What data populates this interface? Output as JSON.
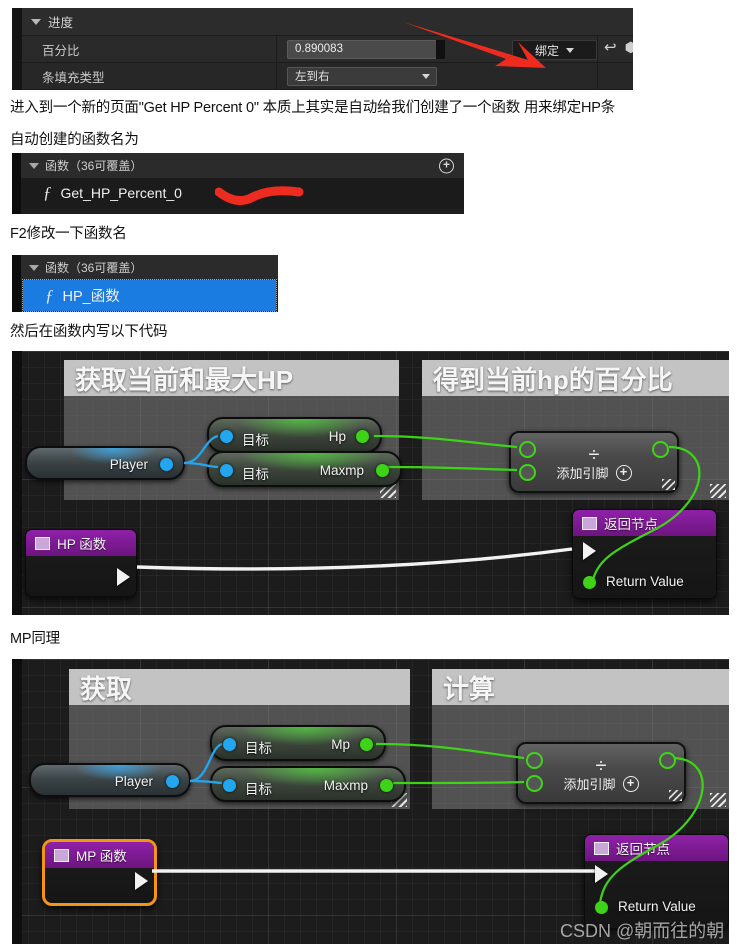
{
  "details_panel": {
    "category_label": "进度",
    "rows": [
      {
        "label": "百分比",
        "value": "0.890083"
      },
      {
        "label": "条填充类型",
        "value": "左到右"
      }
    ],
    "bind_button": "绑定",
    "reset_icon": "undo-arrow-icon",
    "bind_icon": "bind-diamond-icon"
  },
  "notes": {
    "line1": "进入到一个新的页面\"Get HP Percent 0\"  本质上其实是自动给我们创建了一个函数 用来绑定HP条",
    "line2": "自动创建的函数名为",
    "line3": "F2修改一下函数名",
    "line4": "然后在函数内写以下代码",
    "line5": "MP同理"
  },
  "function_panel_1": {
    "header": "函数（36可覆盖）",
    "add_icon": "plus-circle-icon",
    "item": "Get_HP_Percent_0",
    "item_icon": "function-f-icon"
  },
  "function_panel_2": {
    "header": "函数（36可覆盖）",
    "item": "HP_函数",
    "item_icon": "function-f-icon"
  },
  "graph_hp": {
    "comment_left_title": "获取当前和最大HP",
    "comment_right_title": "得到当前hp的百分比",
    "player_node": {
      "label": "Player"
    },
    "getter_top": {
      "target": "目标",
      "output": "Hp"
    },
    "getter_bottom": {
      "target": "目标",
      "output": "Maxmp"
    },
    "divide_node": {
      "glyph": "÷",
      "add_pin": "添加引脚",
      "add_pin_icon": "plus-circle-icon"
    },
    "entry_node": {
      "title": "HP 函数",
      "icon": "node-square-icon"
    },
    "return_node": {
      "title": "返回节点",
      "icon": "node-square-icon",
      "return_value": "Return Value"
    }
  },
  "graph_mp": {
    "comment_left_title": "获取",
    "comment_right_title": "计算",
    "player_node": {
      "label": "Player"
    },
    "getter_top": {
      "target": "目标",
      "output": "Mp"
    },
    "getter_bottom": {
      "target": "目标",
      "output": "Maxmp"
    },
    "divide_node": {
      "glyph": "÷",
      "add_pin": "添加引脚",
      "add_pin_icon": "plus-circle-icon"
    },
    "entry_node": {
      "title": "MP 函数",
      "icon": "node-square-icon"
    },
    "return_node": {
      "title": "返回节点",
      "icon": "node-square-icon",
      "return_value": "Return Value"
    }
  },
  "watermark": "CSDN @朝而往的朝",
  "colors": {
    "accent_blue": "#1a7ce0",
    "exec_white": "#f2f2f2",
    "data_green": "#3ed317",
    "data_blue": "#22a6f0",
    "purple_header": "#8f21a8",
    "highlight_orange": "#f39318",
    "annotation_red": "#ee2b1f"
  }
}
